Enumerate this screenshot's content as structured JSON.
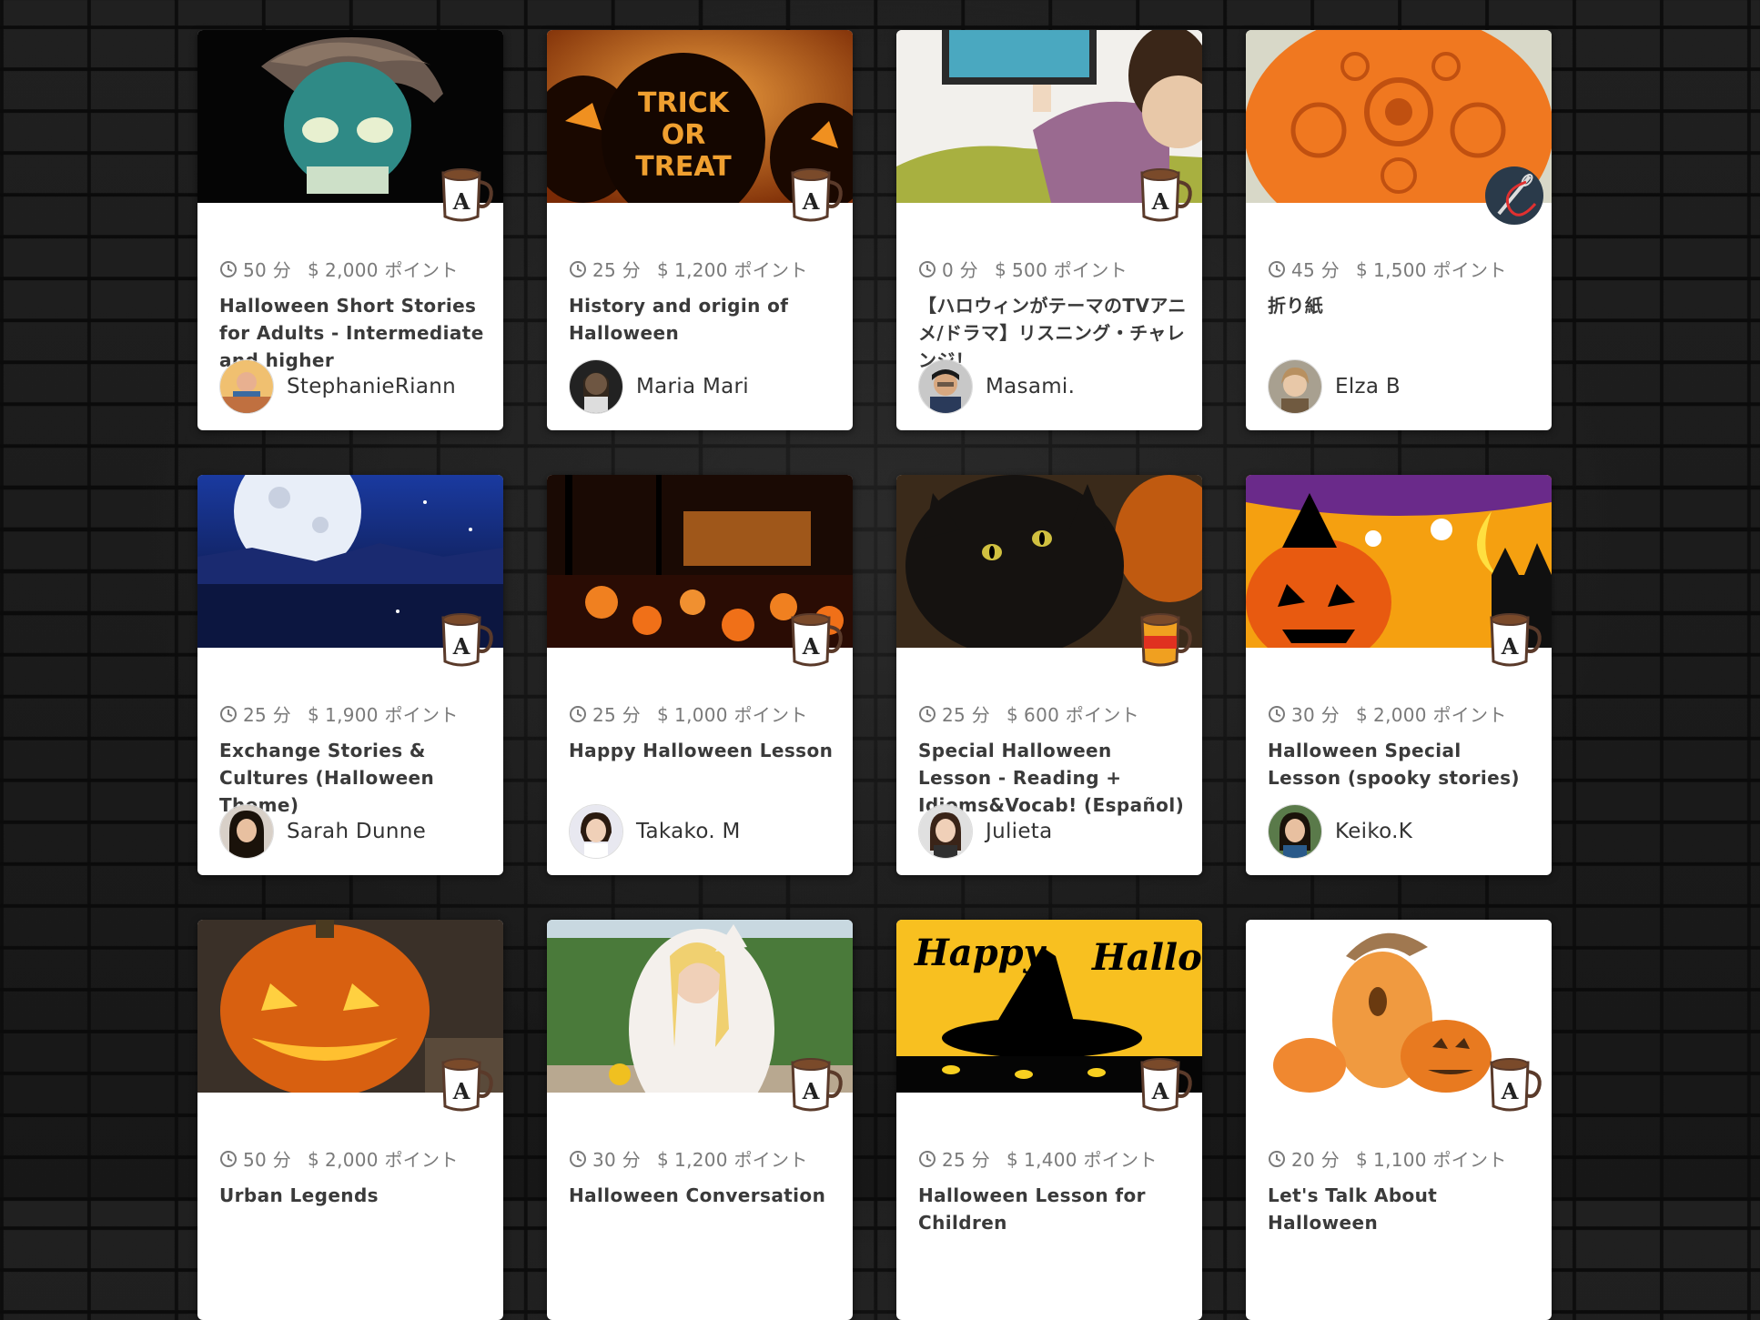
{
  "colors": {
    "card_bg": "#ffffff",
    "meta_text": "#7a7a7a",
    "title_text": "#3a3a3a",
    "background": "#1c1c1c"
  },
  "icons": {
    "duration": "clock-icon",
    "price": "dollar-icon",
    "badge": "coffee-cup-icon"
  },
  "lessons": [
    {
      "duration": "50 分",
      "price": "2,000 ポイント",
      "title": "Halloween Short Stories for Adults - Intermediate and higher",
      "teacher": "StephanieRiann",
      "image": "zombie cartoon",
      "badge": "coffee-cup-icon"
    },
    {
      "duration": "25 分",
      "price": "1,200 ポイント",
      "title": "History and origin of Halloween",
      "teacher": "Maria Mari",
      "image": "trick or treat pumpkin",
      "badge": "coffee-cup-icon"
    },
    {
      "duration": "0 分",
      "price": "500 ポイント",
      "title": "【ハロウィンがテーマのTVアニメ/ドラマ】リスニング・チャレンジ！",
      "teacher": "Masami.",
      "image": "woman watching tv",
      "badge": "coffee-cup-icon"
    },
    {
      "duration": "45 分",
      "price": "1,500 ポイント",
      "title": "折り紙",
      "teacher": "Elza B",
      "image": "carved orange pumpkin",
      "badge": "needle-thread-icon"
    },
    {
      "duration": "25 分",
      "price": "1,900 ポイント",
      "title": "Exchange Stories & Cultures (Halloween Theme)",
      "teacher": "Sarah Dunne",
      "image": "full moon night",
      "badge": "coffee-cup-icon"
    },
    {
      "duration": "25 分",
      "price": "1,000 ポイント",
      "title": "Happy Halloween Lesson",
      "teacher": "Takako. M",
      "image": "jack-o-lanterns park",
      "badge": "coffee-cup-icon"
    },
    {
      "duration": "25 分",
      "price": "600 ポイント",
      "title": "Special Halloween Lesson - Reading + Idioms&Vocab! (Español)",
      "teacher": "Julieta",
      "image": "black cat",
      "badge": "spanish-cup-icon"
    },
    {
      "duration": "30 分",
      "price": "2,000 ポイント",
      "title": "Halloween Special Lesson (spooky stories)",
      "teacher": "Keiko.K",
      "image": "halloween illustration",
      "badge": "coffee-cup-icon"
    },
    {
      "duration": "50 分",
      "price": "2,000 ポイント",
      "title": "Urban Legends",
      "teacher": "",
      "image": "glowing pumpkin",
      "badge": "coffee-cup-icon"
    },
    {
      "duration": "30 分",
      "price": "1,200 ポイント",
      "title": "Halloween Conversation",
      "teacher": "",
      "image": "girl in costume",
      "badge": "coffee-cup-icon"
    },
    {
      "duration": "25 分",
      "price": "1,400 ポイント",
      "title": "Halloween Lesson for Children",
      "teacher": "",
      "image": "happy halloween witch hat",
      "badge": "coffee-cup-icon"
    },
    {
      "duration": "20 分",
      "price": "1,100 ポイント",
      "title": "Let's Talk About Halloween",
      "teacher": "",
      "image": "watercolor pumpkins",
      "badge": "coffee-cup-icon"
    }
  ]
}
